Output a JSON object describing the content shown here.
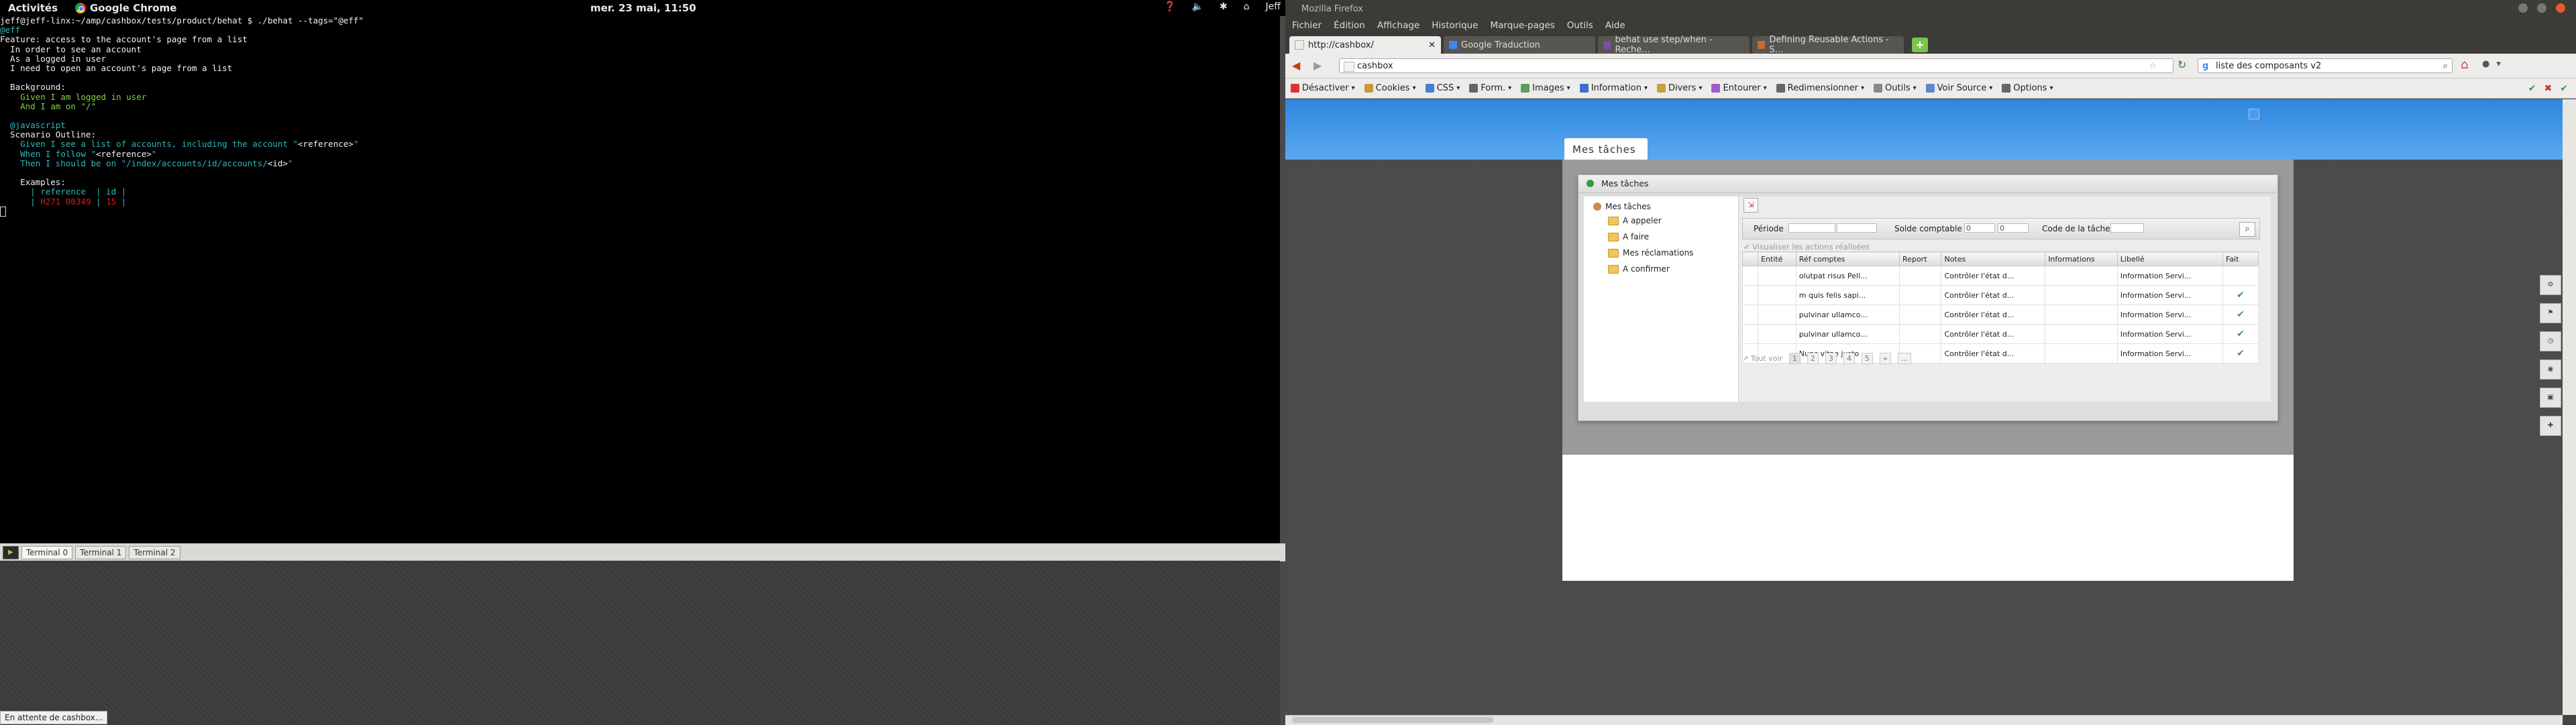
{
  "topbar": {
    "activities": "Activités",
    "app_name": "Google Chrome",
    "clock": "mer. 23 mai, 11:50",
    "user": "Jeff"
  },
  "terminal": {
    "lines": [
      {
        "segments": [
          {
            "t": "jeff@jeff-linx:~/amp/cashbox/tests/product/behat $ ./behat --tags=\"@eff\"",
            "c": "white"
          }
        ]
      },
      {
        "segments": [
          {
            "t": "@eff",
            "c": "cyan"
          }
        ]
      },
      {
        "segments": [
          {
            "t": "Feature: access to the account's page from a list",
            "c": "white"
          }
        ]
      },
      {
        "segments": [
          {
            "t": "  In order to see an account",
            "c": "white"
          }
        ]
      },
      {
        "segments": [
          {
            "t": "  As a logged in user",
            "c": "white"
          }
        ]
      },
      {
        "segments": [
          {
            "t": "  I need to open an account's page from a list",
            "c": "white"
          }
        ]
      },
      {
        "segments": [
          {
            "t": "",
            "c": "white"
          }
        ]
      },
      {
        "segments": [
          {
            "t": "  Background:",
            "c": "white"
          }
        ]
      },
      {
        "segments": [
          {
            "t": "    Given I am logged in user",
            "c": "green"
          }
        ]
      },
      {
        "segments": [
          {
            "t": "    And I am on \"/\"",
            "c": "green"
          }
        ]
      },
      {
        "segments": [
          {
            "t": "",
            "c": "white"
          }
        ]
      },
      {
        "segments": [
          {
            "t": "  @javascript",
            "c": "cyan"
          }
        ]
      },
      {
        "segments": [
          {
            "t": "  Scenario Outline:",
            "c": "white"
          }
        ]
      },
      {
        "segments": [
          {
            "t": "    Given I see a list of accounts, including the account \"",
            "c": "cyan"
          },
          {
            "t": "<reference>",
            "c": "white"
          },
          {
            "t": "\"",
            "c": "cyan"
          }
        ]
      },
      {
        "segments": [
          {
            "t": "    When I follow \"",
            "c": "cyan"
          },
          {
            "t": "<reference>",
            "c": "white"
          },
          {
            "t": "\"",
            "c": "cyan"
          }
        ]
      },
      {
        "segments": [
          {
            "t": "    Then I should be on \"/index/accounts/id/accounts/",
            "c": "cyan"
          },
          {
            "t": "<id>",
            "c": "white"
          },
          {
            "t": "\"",
            "c": "cyan"
          }
        ]
      },
      {
        "segments": [
          {
            "t": "",
            "c": "white"
          }
        ]
      },
      {
        "segments": [
          {
            "t": "    Examples:",
            "c": "white"
          }
        ]
      },
      {
        "segments": [
          {
            "t": "      | reference  | id |",
            "c": "cyan"
          }
        ]
      },
      {
        "segments": [
          {
            "t": "      | ",
            "c": "cyan"
          },
          {
            "t": "H271 00349",
            "c": "red"
          },
          {
            "t": " | ",
            "c": "cyan"
          },
          {
            "t": "15",
            "c": "red"
          },
          {
            "t": " |",
            "c": "cyan"
          }
        ]
      }
    ],
    "tabs": [
      "Terminal 0",
      "Terminal 1",
      "Terminal 2"
    ],
    "status": "En attente de cashbox..."
  },
  "firefox": {
    "title": "Mozilla Firefox",
    "menu": [
      "Fichier",
      "Édition",
      "Affichage",
      "Historique",
      "Marque-pages",
      "Outils",
      "Aide"
    ],
    "tabs": [
      {
        "label": "http://cashbox/",
        "active": true,
        "color": "#888888"
      },
      {
        "label": "Google Traduction",
        "active": false,
        "color": "#4285f4"
      },
      {
        "label": "behat use step/when - Reche...",
        "active": false,
        "color": "#7a4fa0"
      },
      {
        "label": "Defining Reusable Actions - S...",
        "active": false,
        "color": "#cc6633"
      }
    ],
    "url": "cashbox",
    "search": "liste des composants v2",
    "devbar": [
      {
        "label": "Désactiver",
        "color": "#d33"
      },
      {
        "label": "Cookies",
        "color": "#c49a3a"
      },
      {
        "label": "CSS",
        "color": "#4a7fd0"
      },
      {
        "label": "Form.",
        "color": "#666"
      },
      {
        "label": "Images",
        "color": "#5aa05a"
      },
      {
        "label": "Information",
        "color": "#3a70c9"
      },
      {
        "label": "Divers",
        "color": "#c9a13a"
      },
      {
        "label": "Entourer",
        "color": "#a05ac9"
      },
      {
        "label": "Redimensionner",
        "color": "#666"
      },
      {
        "label": "Outils",
        "color": "#888"
      },
      {
        "label": "Voir Source",
        "color": "#5a8ac9"
      },
      {
        "label": "Options",
        "color": "#666"
      }
    ]
  },
  "app": {
    "page_tab": "Mes tâches",
    "dialog_title": "Mes tâches",
    "tree": {
      "root": "Mes tâches",
      "children": [
        "A appeler",
        "A faire",
        "Mes réclamations",
        "A confirmer"
      ]
    },
    "filters": {
      "periode": "Période",
      "solde": "Solde comptable",
      "solde_min": "0",
      "solde_max": "0",
      "code": "Code de la tâche"
    },
    "visualiser": "Visualiser les actions réalisées",
    "columns": [
      "Entité",
      "Réf comptes",
      "Report",
      "Notes",
      "Informations",
      "Libellé",
      "Fait"
    ],
    "rows": [
      {
        "ref": "olutpat risus Pell...",
        "notes": "Contrôler l'état d...",
        "lib": "Information Servi...",
        "fait": false
      },
      {
        "ref": "m quis felis sapi...",
        "notes": "Contrôler l'état d...",
        "lib": "Information Servi...",
        "fait": true
      },
      {
        "ref": "pulvinar ullamco...",
        "notes": "Contrôler l'état d...",
        "lib": "Information Servi...",
        "fait": true
      },
      {
        "ref": "pulvinar ullamco...",
        "notes": "Contrôler l'état d...",
        "lib": "Information Servi...",
        "fait": true
      },
      {
        "ref": "Nunc vitae justo ...",
        "notes": "Contrôler l'état d...",
        "lib": "Information Servi...",
        "fait": true
      }
    ],
    "pager": {
      "all": "Tout voir",
      "pages": [
        "1",
        "2",
        "3",
        "4",
        "5",
        "»",
        "..."
      ]
    }
  }
}
